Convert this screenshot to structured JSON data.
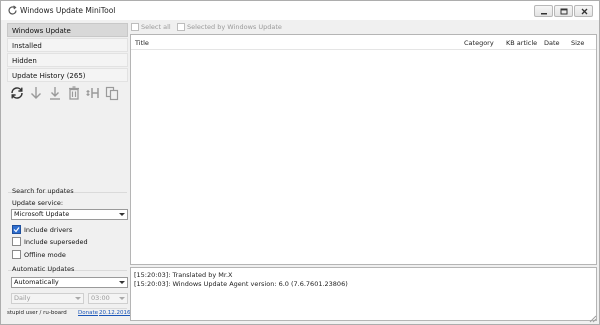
{
  "window": {
    "title": "Windows Update MiniTool"
  },
  "nav": {
    "items": [
      {
        "label": "Windows Update"
      },
      {
        "label": "Installed"
      },
      {
        "label": "Hidden"
      },
      {
        "label": "Update History (265)"
      }
    ]
  },
  "toolbar": {
    "icons": [
      "refresh-icon",
      "download-icon",
      "install-icon",
      "delete-icon",
      "hide-icon",
      "copy-icon"
    ]
  },
  "search": {
    "group_label": "Search for updates",
    "service_label": "Update service:",
    "service_value": "Microsoft Update",
    "include_drivers": {
      "label": "Include drivers",
      "checked": true
    },
    "include_superseded": {
      "label": "Include superseded",
      "checked": false
    },
    "offline_mode": {
      "label": "Offline mode",
      "checked": false
    }
  },
  "auto": {
    "group_label": "Automatic Updates",
    "mode_value": "Automatically",
    "schedule_value": "Daily",
    "time_value": "03:00"
  },
  "footer": {
    "credit": "stupid user / ru-board",
    "donate_label": "Donate",
    "date": "20.12.2016"
  },
  "top": {
    "select_all": "Select all",
    "selected_by_wu": "Selected by Windows Update"
  },
  "columns": [
    "Title",
    "Category",
    "KB article",
    "Date",
    "Size"
  ],
  "log": [
    "[15:20:03]: Translated by Mr.X",
    "[15:20:03]: Windows Update Agent version: 6.0 (7.6.7601.23806)"
  ],
  "colors": {
    "accent": "#2f6ecf",
    "link": "#1a55b8",
    "icon": "#8a8a8a"
  }
}
